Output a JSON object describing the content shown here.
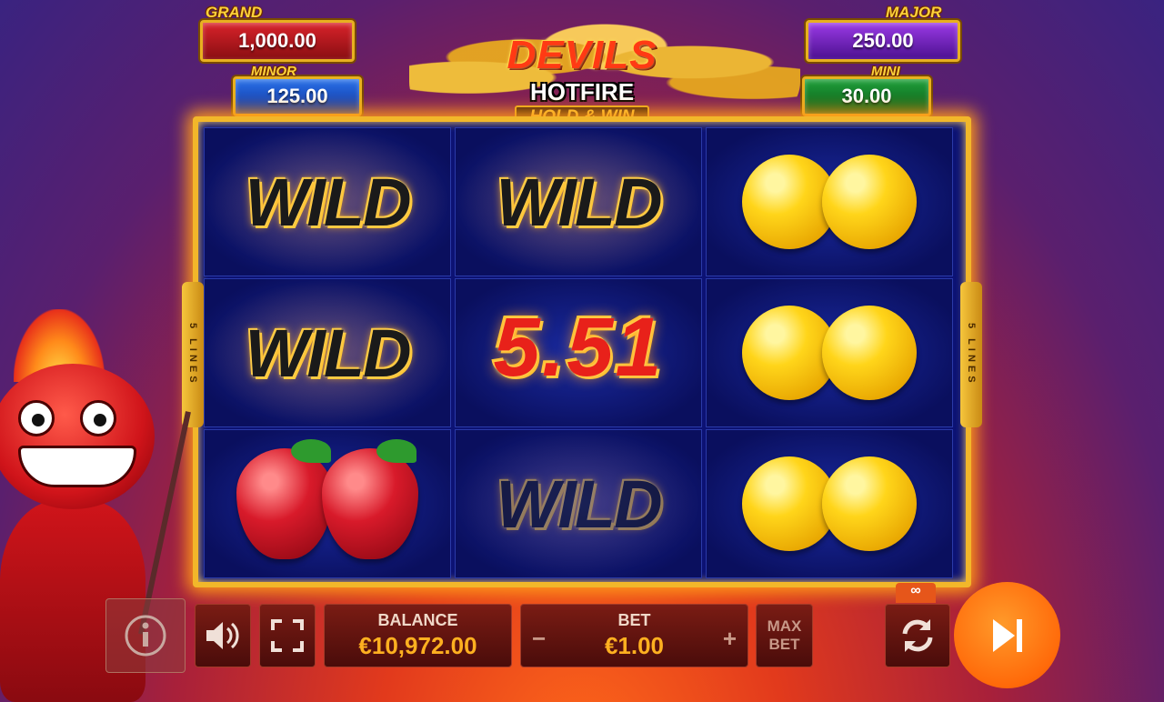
{
  "jackpots": {
    "grand": {
      "label": "GRAND",
      "value": "1,000.00"
    },
    "minor": {
      "label": "MINOR",
      "value": "125.00"
    },
    "major": {
      "label": "MAJOR",
      "value": "250.00"
    },
    "mini": {
      "label": "MINI",
      "value": "30.00"
    }
  },
  "logo": {
    "line1": "DEVILS",
    "line2": "HOTFIRE",
    "line3": "HOLD & WIN"
  },
  "lines_label": "5 LINES",
  "reels": [
    [
      "WILD",
      "WILD",
      "strawberry"
    ],
    [
      "WILD",
      "5.51",
      "WILD"
    ],
    [
      "lemon",
      "lemon",
      "lemon"
    ]
  ],
  "wild_text": "WILD",
  "win_amount": "5.51",
  "controls": {
    "balance_label": "BALANCE",
    "balance_value": "€10,972.00",
    "bet_label": "BET",
    "bet_value": "€1.00",
    "bet_minus": "−",
    "bet_plus": "+",
    "max_bet_line1": "MAX",
    "max_bet_line2": "BET",
    "autoplay_count": "∞"
  },
  "icons": [
    "info-icon",
    "speaker-icon",
    "fullscreen-icon",
    "autoplay-icon",
    "skip-forward-icon"
  ],
  "colors": {
    "accent": "#ffb020",
    "spin": "#ff6a0a",
    "frame": "#f2b72a"
  }
}
